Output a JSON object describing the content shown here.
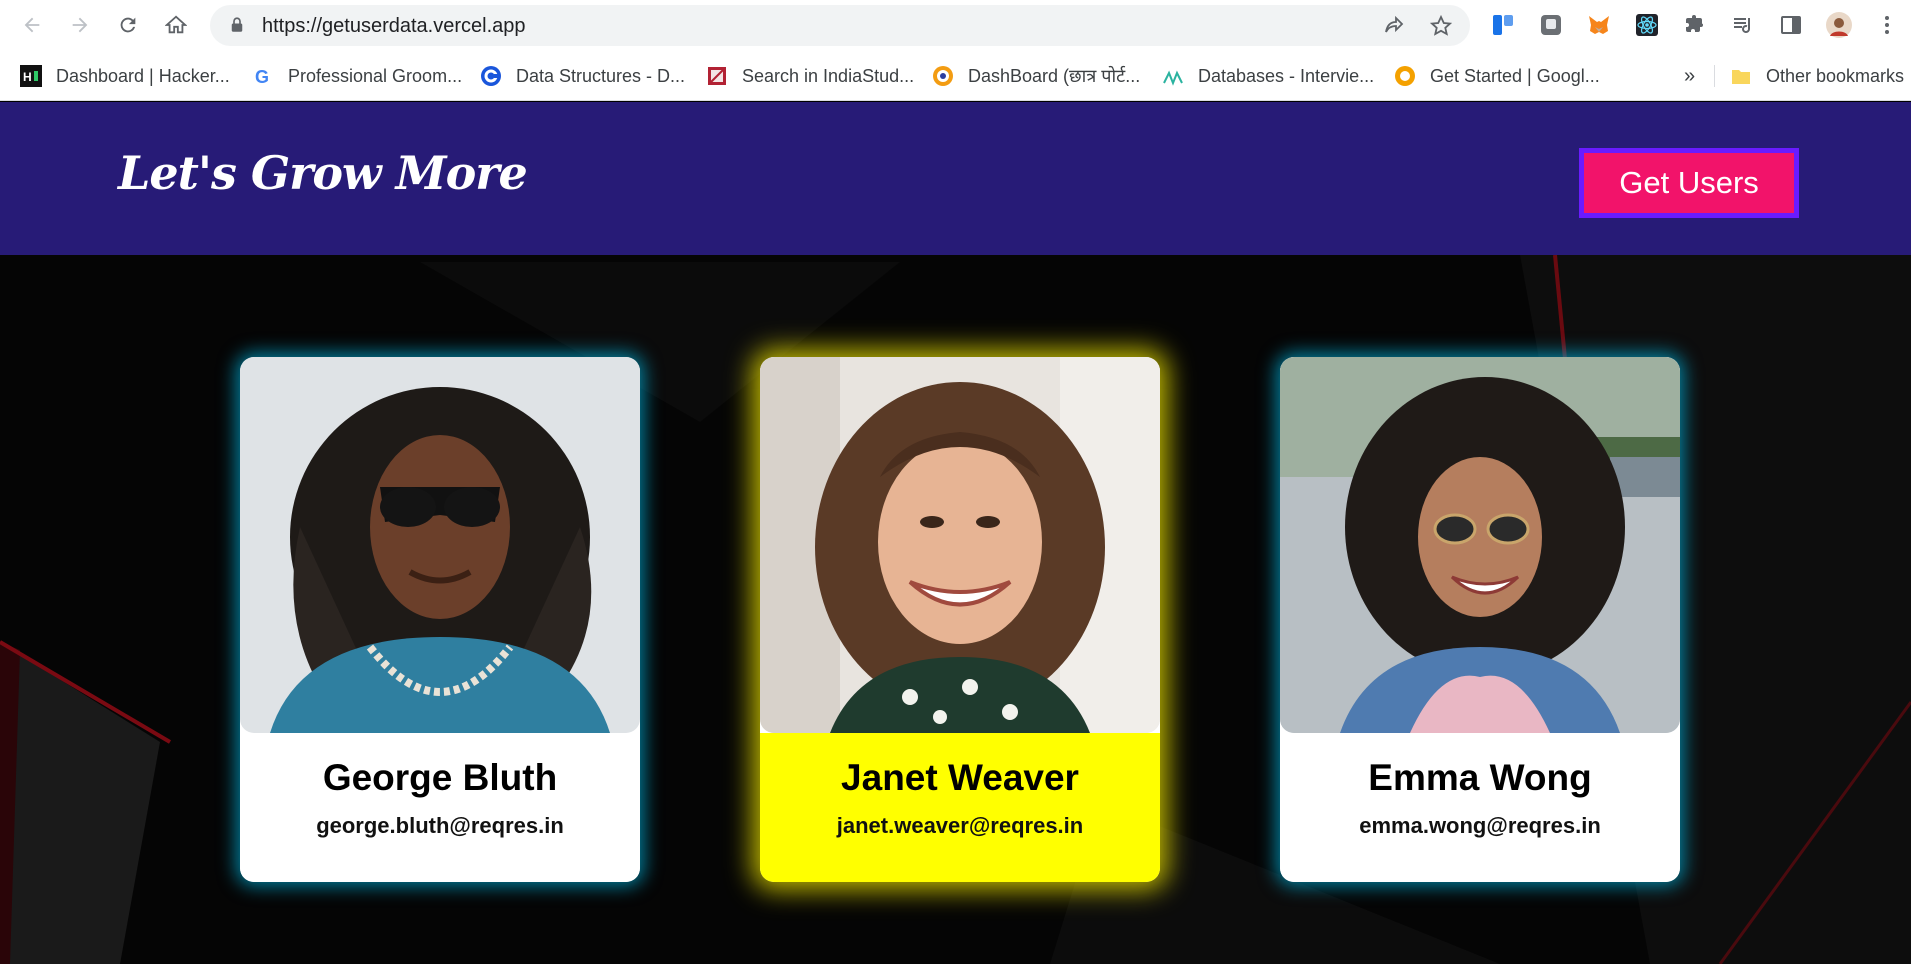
{
  "browser": {
    "url": "https://getuserdata.vercel.app",
    "bookmarks": [
      {
        "label": "Dashboard | Hacker...",
        "icon": "hackerrank-icon"
      },
      {
        "label": "Professional Groom...",
        "icon": "google-icon"
      },
      {
        "label": "Data Structures - D...",
        "icon": "codechef-icon"
      },
      {
        "label": "Search in IndiaStud...",
        "icon": "indiastudychannel-icon"
      },
      {
        "label": "DashBoard (छात्र पोर्ट...",
        "icon": "portal-emblem-icon"
      },
      {
        "label": "Databases - Intervie...",
        "icon": "interviewbit-icon"
      },
      {
        "label": "Get Started | Googl...",
        "icon": "google-dev-icon"
      }
    ],
    "overflow_label": "»",
    "other_bookmarks_label": "Other bookmarks",
    "extensions": [
      "trello-icon",
      "extension-grey-icon",
      "metamask-icon",
      "react-devtools-icon",
      "puzzle-icon",
      "media-queue-icon",
      "side-panel-icon",
      "profile-avatar-icon",
      "kebab-menu-icon"
    ]
  },
  "site": {
    "logo": "Let's Grow More",
    "get_users_button": "Get Users"
  },
  "users": [
    {
      "name": "George Bluth",
      "email": "george.bluth@reqres.in",
      "highlight": false
    },
    {
      "name": "Janet Weaver",
      "email": "janet.weaver@reqres.in",
      "highlight": true
    },
    {
      "name": "Emma Wong",
      "email": "emma.wong@reqres.in",
      "highlight": false
    }
  ],
  "colors": {
    "header_bg": "#271b77",
    "button_bg": "#f2136a",
    "button_border": "#6a1bff",
    "highlight_card_bg": "#ffff00",
    "card_glow": "#00aad2"
  }
}
